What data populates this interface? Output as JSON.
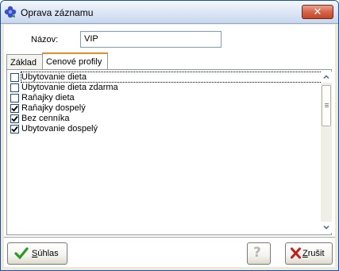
{
  "window": {
    "title": "Oprava záznamu",
    "close_glyph": "✕",
    "icon": "violet-flower-icon"
  },
  "form": {
    "name_label": "Názov:",
    "name_value": "VIP"
  },
  "tabs": [
    {
      "label": "Základ",
      "active": false
    },
    {
      "label": "Cenové profily",
      "active": true
    }
  ],
  "profiles": [
    {
      "label": "Ubytovanie dieta",
      "checked": false,
      "focused": true
    },
    {
      "label": "Ubytovanie dieta zdarma",
      "checked": false,
      "focused": false
    },
    {
      "label": "Raňajky dieta",
      "checked": false,
      "focused": false
    },
    {
      "label": "Raňajky dospelý",
      "checked": true,
      "focused": false
    },
    {
      "label": "Bez cenníka",
      "checked": true,
      "focused": false
    },
    {
      "label": "Ubytovanie dospelý",
      "checked": true,
      "focused": false
    }
  ],
  "buttons": {
    "ok_label": "úhlas",
    "ok_accel": "S",
    "help_glyph": "?",
    "cancel_label": "rušit",
    "cancel_accel": "Z"
  },
  "colors": {
    "ok_check": "#2a9a22",
    "cancel_x": "#c0201a",
    "title_icon": "#3348b8"
  }
}
